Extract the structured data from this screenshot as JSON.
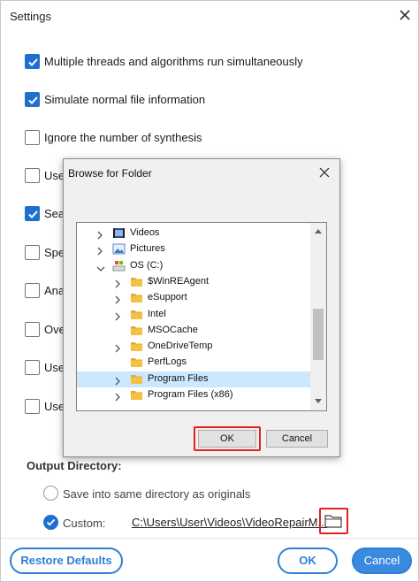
{
  "window": {
    "title": "Settings"
  },
  "options": [
    {
      "label": "Multiple threads and algorithms run simultaneously",
      "checked": true
    },
    {
      "label": "Simulate normal file information",
      "checked": true
    },
    {
      "label": "Ignore the number of synthesis",
      "checked": false
    },
    {
      "label": "Use",
      "checked": false
    },
    {
      "label": "Sear",
      "checked": true
    },
    {
      "label": "Spec",
      "checked": false
    },
    {
      "label": "Anal",
      "checked": false
    },
    {
      "label": "Ove",
      "checked": false
    },
    {
      "label": "Use",
      "checked": false
    },
    {
      "label": "Use",
      "checked": false
    }
  ],
  "output": {
    "title": "Output Directory:",
    "same_dir_label": "Save into same directory as originals",
    "custom_label": "Custom:",
    "custom_path": "C:\\Users\\User\\Videos\\VideoRepairM..."
  },
  "footer": {
    "restore_label": "Restore Defaults",
    "ok_label": "OK",
    "cancel_label": "Cancel"
  },
  "dialog": {
    "title": "Browse for Folder",
    "ok_label": "OK",
    "cancel_label": "Cancel",
    "tree": [
      {
        "label": "Videos",
        "indent": 0,
        "arrow": "right",
        "icon": "videos-folder-icon"
      },
      {
        "label": "Pictures",
        "indent": 0,
        "arrow": "right",
        "icon": "pictures-folder-icon"
      },
      {
        "label": "OS (C:)",
        "indent": 0,
        "arrow": "down",
        "icon": "drive-icon"
      },
      {
        "label": "$WinREAgent",
        "indent": 1,
        "arrow": "right",
        "icon": "folder-icon"
      },
      {
        "label": "eSupport",
        "indent": 1,
        "arrow": "right",
        "icon": "folder-icon"
      },
      {
        "label": "Intel",
        "indent": 1,
        "arrow": "right",
        "icon": "folder-icon"
      },
      {
        "label": "MSOCache",
        "indent": 1,
        "arrow": "none",
        "icon": "folder-icon"
      },
      {
        "label": "OneDriveTemp",
        "indent": 1,
        "arrow": "right",
        "icon": "folder-icon"
      },
      {
        "label": "PerfLogs",
        "indent": 1,
        "arrow": "none",
        "icon": "folder-icon"
      },
      {
        "label": "Program Files",
        "indent": 1,
        "arrow": "right",
        "icon": "folder-icon",
        "selected": true
      },
      {
        "label": "Program Files (x86)",
        "indent": 1,
        "arrow": "right",
        "icon": "folder-icon"
      }
    ]
  },
  "colors": {
    "accent": "#1f6fd1",
    "highlight": "#e02020",
    "selection": "#cce8ff",
    "folder": "#f3c143"
  }
}
